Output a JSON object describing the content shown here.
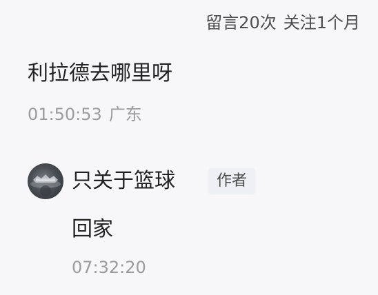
{
  "header": {
    "comment_count": "留言20次",
    "follow_duration": "关注1个月"
  },
  "comment": {
    "text": "利拉德去哪里呀",
    "time": "01:50:53",
    "location": "广东"
  },
  "reply": {
    "author": "只关于篮球",
    "badge": "作者",
    "text": "回家",
    "time": "07:32:20",
    "avatar_icon": "author-avatar-icon"
  },
  "colors": {
    "background": "#f7f7f9",
    "primary_text": "#222222",
    "meta_text": "#4d4d4d",
    "muted_text": "#9b9b9b",
    "badge_bg": "#eef0f5"
  }
}
